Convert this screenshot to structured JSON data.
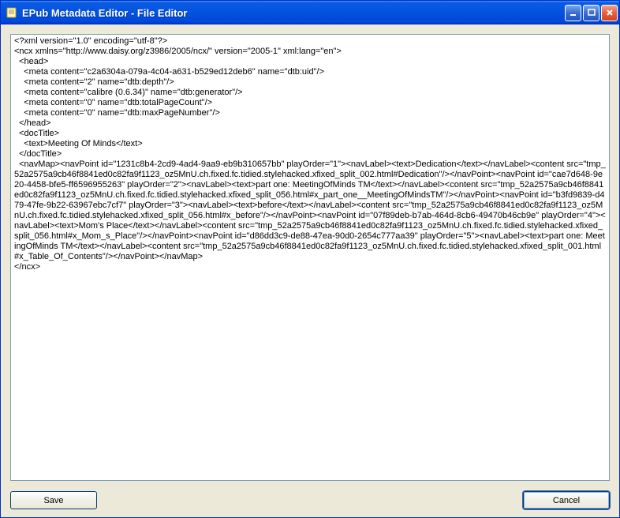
{
  "window": {
    "title": "EPub Metadata Editor - File Editor"
  },
  "editor": {
    "content": "<?xml version=\"1.0\" encoding=\"utf-8\"?>\n<ncx xmlns=\"http://www.daisy.org/z3986/2005/ncx/\" version=\"2005-1\" xml:lang=\"en\">\n  <head>\n    <meta content=\"c2a6304a-079a-4c04-a631-b529ed12deb6\" name=\"dtb:uid\"/>\n    <meta content=\"2\" name=\"dtb:depth\"/>\n    <meta content=\"calibre (0.6.34)\" name=\"dtb:generator\"/>\n    <meta content=\"0\" name=\"dtb:totalPageCount\"/>\n    <meta content=\"0\" name=\"dtb:maxPageNumber\"/>\n  </head>\n  <docTitle>\n    <text>Meeting Of Minds</text>\n  </docTitle>\n  <navMap><navPoint id=\"1231c8b4-2cd9-4ad4-9aa9-eb9b310657bb\" playOrder=\"1\"><navLabel><text>Dedication</text></navLabel><content src=\"tmp_52a2575a9cb46f8841ed0c82fa9f1123_oz5MnU.ch.fixed.fc.tidied.stylehacked.xfixed_split_002.html#Dedication\"/></navPoint><navPoint id=\"cae7d648-9e20-4458-bfe5-ff6596955263\" playOrder=\"2\"><navLabel><text>part one: MeetingOfMinds TM</text></navLabel><content src=\"tmp_52a2575a9cb46f8841ed0c82fa9f1123_oz5MnU.ch.fixed.fc.tidied.stylehacked.xfixed_split_056.html#x_part_one__MeetingOfMindsTM\"/></navPoint><navPoint id=\"b3fd9839-d479-47fe-9b22-63967ebc7cf7\" playOrder=\"3\"><navLabel><text>before</text></navLabel><content src=\"tmp_52a2575a9cb46f8841ed0c82fa9f1123_oz5MnU.ch.fixed.fc.tidied.stylehacked.xfixed_split_056.html#x_before\"/></navPoint><navPoint id=\"07f89deb-b7ab-464d-8cb6-49470b46cb9e\" playOrder=\"4\"><navLabel><text>Mom's Place</text></navLabel><content src=\"tmp_52a2575a9cb46f8841ed0c82fa9f1123_oz5MnU.ch.fixed.fc.tidied.stylehacked.xfixed_split_056.html#x_Mom_s_Place\"/></navPoint><navPoint id=\"d86dd3c9-de88-47ea-90d0-2654c777aa39\" playOrder=\"5\"><navLabel><text>part one: MeetingOfMinds TM</text></navLabel><content src=\"tmp_52a2575a9cb46f8841ed0c82fa9f1123_oz5MnU.ch.fixed.fc.tidied.stylehacked.xfixed_split_001.html#x_Table_Of_Contents\"/></navPoint></navMap>\n</ncx>"
  },
  "buttons": {
    "save": "Save",
    "cancel": "Cancel"
  }
}
